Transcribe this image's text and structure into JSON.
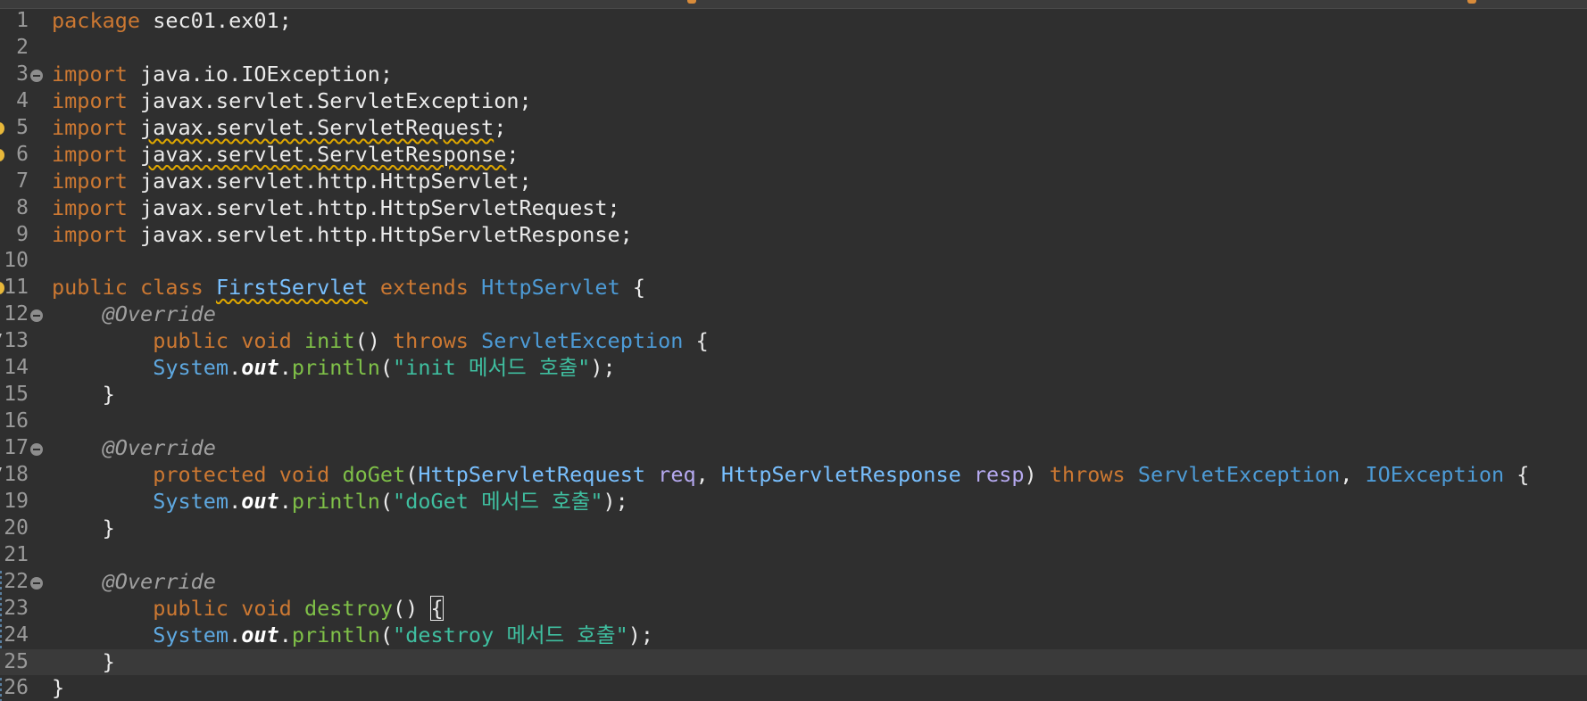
{
  "editor": {
    "language": "Java",
    "lines": [
      {
        "n": "1",
        "tokens": [
          {
            "t": "package",
            "c": "kw"
          },
          {
            "t": " sec01.ex01;",
            "c": "pl"
          }
        ]
      },
      {
        "n": "2",
        "tokens": []
      },
      {
        "n": "3",
        "fold": true,
        "tokens": [
          {
            "t": "import",
            "c": "kw"
          },
          {
            "t": " java.io.IOException;",
            "c": "pl"
          }
        ]
      },
      {
        "n": "4",
        "tokens": [
          {
            "t": "import",
            "c": "kw"
          },
          {
            "t": " javax.servlet.ServletException;",
            "c": "pl"
          }
        ]
      },
      {
        "n": "5",
        "warning": true,
        "tokens": [
          {
            "t": "import",
            "c": "kw"
          },
          {
            "t": " ",
            "c": "pl"
          },
          {
            "t": "javax.servlet.ServletRequest",
            "c": "pl",
            "wavy": true
          },
          {
            "t": ";",
            "c": "pl"
          }
        ]
      },
      {
        "n": "6",
        "warning": true,
        "tokens": [
          {
            "t": "import",
            "c": "kw"
          },
          {
            "t": " ",
            "c": "pl"
          },
          {
            "t": "javax.servlet.ServletResponse",
            "c": "pl",
            "wavy": true
          },
          {
            "t": ";",
            "c": "pl"
          }
        ]
      },
      {
        "n": "7",
        "tokens": [
          {
            "t": "import",
            "c": "kw"
          },
          {
            "t": " javax.servlet.http.HttpServlet;",
            "c": "pl"
          }
        ]
      },
      {
        "n": "8",
        "tokens": [
          {
            "t": "import",
            "c": "kw"
          },
          {
            "t": " javax.servlet.http.HttpServletRequest;",
            "c": "pl"
          }
        ]
      },
      {
        "n": "9",
        "tokens": [
          {
            "t": "import",
            "c": "kw"
          },
          {
            "t": " javax.servlet.http.HttpServletResponse;",
            "c": "pl"
          }
        ]
      },
      {
        "n": "10",
        "tokens": []
      },
      {
        "n": "11",
        "warning": true,
        "tokens": [
          {
            "t": "public",
            "c": "kw"
          },
          {
            "t": " ",
            "c": "pl"
          },
          {
            "t": "class",
            "c": "kw"
          },
          {
            "t": " ",
            "c": "pl"
          },
          {
            "t": "FirstServlet",
            "c": "tp",
            "wavy": true
          },
          {
            "t": " ",
            "c": "pl"
          },
          {
            "t": "extends",
            "c": "kw"
          },
          {
            "t": " ",
            "c": "pl"
          },
          {
            "t": "HttpServlet",
            "c": "cls"
          },
          {
            "t": " {",
            "c": "pl"
          }
        ]
      },
      {
        "n": "12",
        "fold": true,
        "tokens": [
          {
            "t": "    ",
            "c": "pl"
          },
          {
            "t": "@Override",
            "c": "ann"
          }
        ]
      },
      {
        "n": "13",
        "override": true,
        "tokens": [
          {
            "t": "        ",
            "c": "pl"
          },
          {
            "t": "public",
            "c": "kw"
          },
          {
            "t": " ",
            "c": "pl"
          },
          {
            "t": "void",
            "c": "kw"
          },
          {
            "t": " ",
            "c": "pl"
          },
          {
            "t": "init",
            "c": "mth"
          },
          {
            "t": "() ",
            "c": "pl"
          },
          {
            "t": "throws",
            "c": "kw"
          },
          {
            "t": " ",
            "c": "pl"
          },
          {
            "t": "ServletException",
            "c": "cls"
          },
          {
            "t": " {",
            "c": "pl"
          }
        ]
      },
      {
        "n": "14",
        "tokens": [
          {
            "t": "        ",
            "c": "pl"
          },
          {
            "t": "System",
            "c": "sys"
          },
          {
            "t": ".",
            "c": "pl"
          },
          {
            "t": "out",
            "c": "fld"
          },
          {
            "t": ".",
            "c": "pl"
          },
          {
            "t": "println",
            "c": "mth"
          },
          {
            "t": "(",
            "c": "pl"
          },
          {
            "t": "\"init 메서드 호출\"",
            "c": "str"
          },
          {
            "t": ");",
            "c": "pl"
          }
        ]
      },
      {
        "n": "15",
        "tokens": [
          {
            "t": "    }",
            "c": "pl"
          }
        ]
      },
      {
        "n": "16",
        "tokens": []
      },
      {
        "n": "17",
        "fold": true,
        "tokens": [
          {
            "t": "    ",
            "c": "pl"
          },
          {
            "t": "@Override",
            "c": "ann"
          }
        ]
      },
      {
        "n": "18",
        "override": true,
        "tokens": [
          {
            "t": "        ",
            "c": "pl"
          },
          {
            "t": "protected",
            "c": "kw"
          },
          {
            "t": " ",
            "c": "pl"
          },
          {
            "t": "void",
            "c": "kw"
          },
          {
            "t": " ",
            "c": "pl"
          },
          {
            "t": "doGet",
            "c": "mth"
          },
          {
            "t": "(",
            "c": "pl"
          },
          {
            "t": "HttpServletRequest",
            "c": "tp"
          },
          {
            "t": " ",
            "c": "pl"
          },
          {
            "t": "req",
            "c": "prm"
          },
          {
            "t": ", ",
            "c": "pl"
          },
          {
            "t": "HttpServletResponse",
            "c": "tp"
          },
          {
            "t": " ",
            "c": "pl"
          },
          {
            "t": "resp",
            "c": "prm"
          },
          {
            "t": ") ",
            "c": "pl"
          },
          {
            "t": "throws",
            "c": "kw"
          },
          {
            "t": " ",
            "c": "pl"
          },
          {
            "t": "ServletException",
            "c": "cls"
          },
          {
            "t": ", ",
            "c": "pl"
          },
          {
            "t": "IOException",
            "c": "cls"
          },
          {
            "t": " {",
            "c": "pl"
          }
        ]
      },
      {
        "n": "19",
        "tokens": [
          {
            "t": "        ",
            "c": "pl"
          },
          {
            "t": "System",
            "c": "sys"
          },
          {
            "t": ".",
            "c": "pl"
          },
          {
            "t": "out",
            "c": "fld"
          },
          {
            "t": ".",
            "c": "pl"
          },
          {
            "t": "println",
            "c": "mth"
          },
          {
            "t": "(",
            "c": "pl"
          },
          {
            "t": "\"doGet 메서드 호출\"",
            "c": "str"
          },
          {
            "t": ");",
            "c": "pl"
          }
        ]
      },
      {
        "n": "20",
        "tokens": [
          {
            "t": "    }",
            "c": "pl"
          }
        ]
      },
      {
        "n": "21",
        "tokens": []
      },
      {
        "n": "22",
        "fold": true,
        "tokens": [
          {
            "t": "    ",
            "c": "pl"
          },
          {
            "t": "@Override",
            "c": "ann"
          }
        ]
      },
      {
        "n": "23",
        "tokens": [
          {
            "t": "        ",
            "c": "pl"
          },
          {
            "t": "public",
            "c": "kw"
          },
          {
            "t": " ",
            "c": "pl"
          },
          {
            "t": "void",
            "c": "kw"
          },
          {
            "t": " ",
            "c": "pl"
          },
          {
            "t": "destroy",
            "c": "mth"
          },
          {
            "t": "() ",
            "c": "pl"
          },
          {
            "t": "{",
            "c": "pl",
            "caret": true
          }
        ]
      },
      {
        "n": "24",
        "tokens": [
          {
            "t": "        ",
            "c": "pl"
          },
          {
            "t": "System",
            "c": "sys"
          },
          {
            "t": ".",
            "c": "pl"
          },
          {
            "t": "out",
            "c": "fld"
          },
          {
            "t": ".",
            "c": "pl"
          },
          {
            "t": "println",
            "c": "mth"
          },
          {
            "t": "(",
            "c": "pl"
          },
          {
            "t": "\"destroy 메서드 호출\"",
            "c": "str"
          },
          {
            "t": ");",
            "c": "pl"
          }
        ]
      },
      {
        "n": "25",
        "current": true,
        "tokens": [
          {
            "t": "    }",
            "c": "pl"
          }
        ]
      },
      {
        "n": "26",
        "tokens": [
          {
            "t": "}",
            "c": "pl"
          }
        ]
      }
    ]
  },
  "colors": {
    "background": "#2f2f2f",
    "keyword": "#cc7832",
    "type": "#4d9bd6",
    "method": "#7fc048",
    "string": "#3fbfa0",
    "annotation": "#a0a0a0",
    "warning_underline": "#e0a800",
    "current_line": "#3a3a3a"
  }
}
